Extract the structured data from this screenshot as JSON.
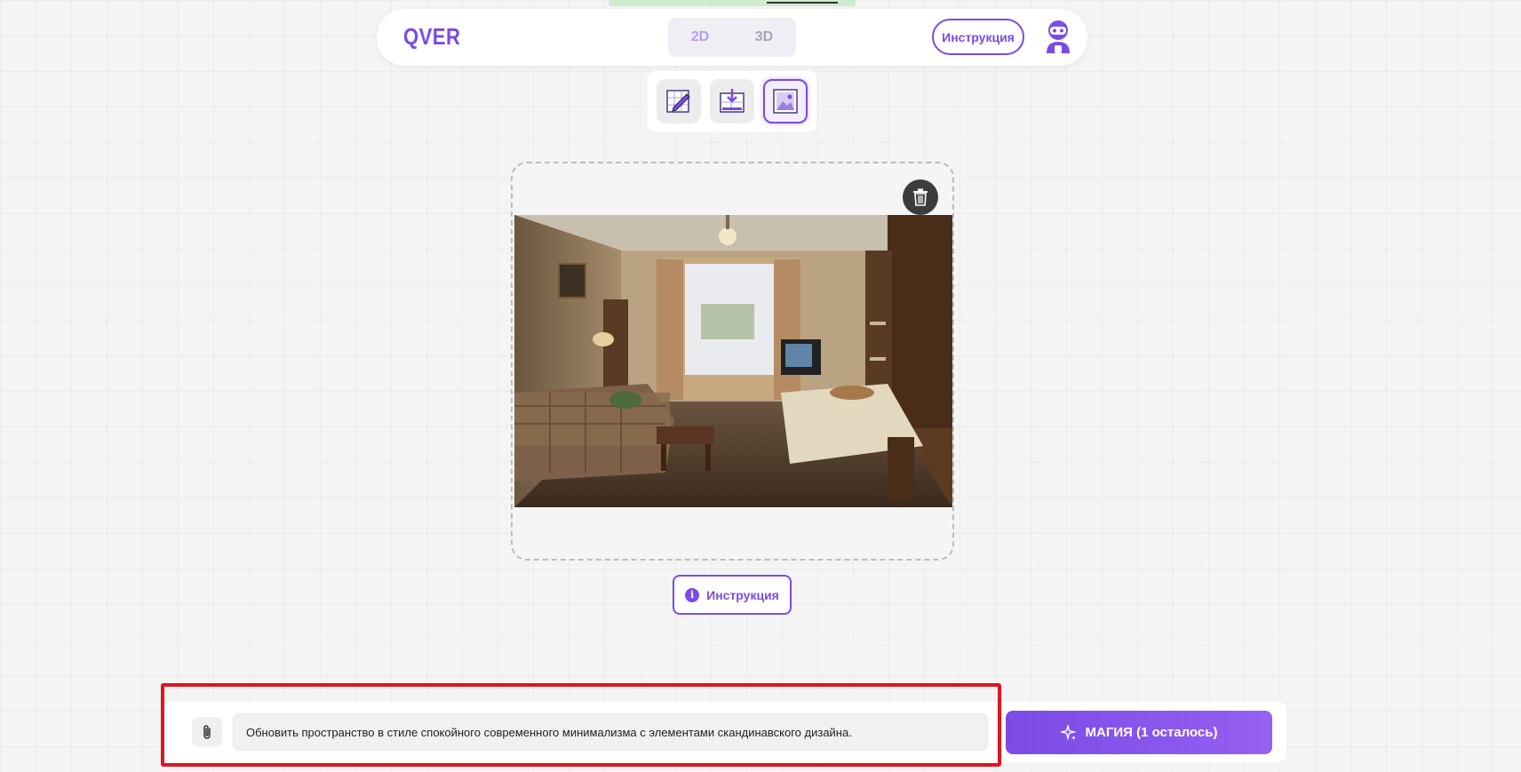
{
  "header": {
    "logo": "QVER",
    "modes": [
      "2D",
      "3D"
    ],
    "active_mode": "2D",
    "instruction_label": "Инструкция",
    "avatar_icon": "robot-avatar-icon"
  },
  "tools": [
    {
      "icon": "pencil-edit-icon",
      "active": false
    },
    {
      "icon": "download-plan-icon",
      "active": false
    },
    {
      "icon": "image-redesign-icon",
      "active": true
    }
  ],
  "upload": {
    "delete_icon": "trash-icon",
    "image_icon": "room-photo"
  },
  "help": {
    "instruction_label": "Инструкция",
    "icon": "info-icon"
  },
  "prompt": {
    "attach_icon": "paperclip-icon",
    "value": "Обновить пространство в стиле спокойного современного минимализма с элементами скандинавского дизайна.",
    "submit_label": "МАГИЯ (1 осталось)",
    "submit_icon": "sparkle-icon"
  },
  "colors": {
    "accent": "#7b4be6",
    "highlight": "#e0141e"
  }
}
